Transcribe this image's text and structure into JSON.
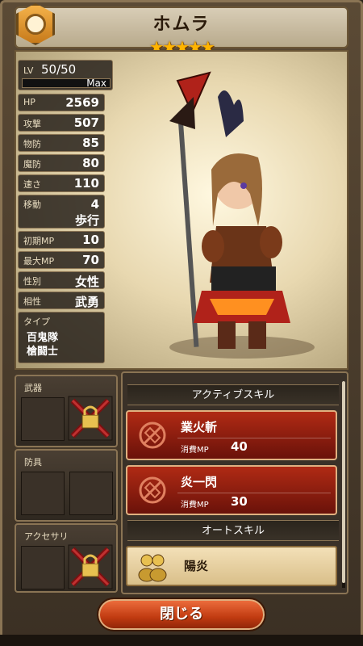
{
  "header": {
    "name": "ホムラ",
    "stars": "★★★★★"
  },
  "stats": {
    "lv_label": "LV",
    "lv_value": "50/50",
    "max_label": "Max",
    "rows": [
      {
        "name": "HP",
        "value": "2569"
      },
      {
        "name": "攻撃",
        "value": "507"
      },
      {
        "name": "物防",
        "value": "85"
      },
      {
        "name": "魔防",
        "value": "80"
      },
      {
        "name": "速さ",
        "value": "110"
      }
    ],
    "move": {
      "name": "移動",
      "value": "4",
      "value2": "歩行"
    },
    "rows2": [
      {
        "name": "初期MP",
        "value": "10"
      },
      {
        "name": "最大MP",
        "value": "70"
      },
      {
        "name": "性別",
        "value": "女性"
      },
      {
        "name": "相性",
        "value": "武勇"
      }
    ],
    "type_label": "タイプ",
    "type_values": [
      "百鬼隊",
      "槍闘士"
    ]
  },
  "equipment": {
    "weapon_label": "武器",
    "armor_label": "防具",
    "accessory_label": "アクセサリ"
  },
  "skills": {
    "active_header": "アクティブスキル",
    "active": [
      {
        "name": "業火斬",
        "mp_label": "消費MP",
        "mp": "40"
      },
      {
        "name": "炎一閃",
        "mp_label": "消費MP",
        "mp": "30"
      }
    ],
    "auto_header": "オートスキル",
    "auto": [
      {
        "name": "陽炎"
      }
    ]
  },
  "close_label": "閉じる",
  "colors": {
    "accent": "#c03a10",
    "star": "#ffb400",
    "skill_card": "#8a1a0c",
    "auto_card": "#e8d0a0"
  }
}
